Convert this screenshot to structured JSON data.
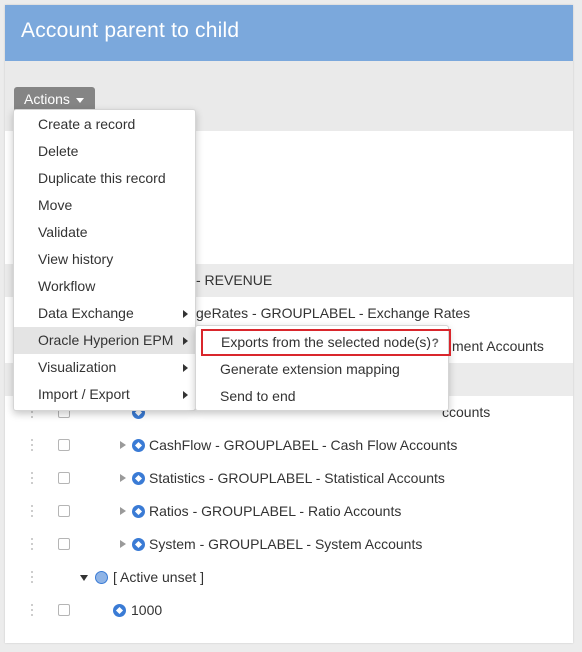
{
  "window": {
    "title": "Account parent to child"
  },
  "toolbar": {
    "actions_label": "Actions"
  },
  "tree": {
    "rows": [
      {
        "text": "- REVENUE"
      },
      {
        "text": "geRates - GROUPLABEL - Exchange Rates"
      },
      {
        "text": "ment Accounts"
      },
      {
        "text": "ccounts"
      },
      {
        "text": "CashFlow - GROUPLABEL - Cash Flow Accounts"
      },
      {
        "text": "Statistics - GROUPLABEL - Statistical Accounts"
      },
      {
        "text": "Ratios - GROUPLABEL - Ratio Accounts"
      },
      {
        "text": "System - GROUPLABEL - System Accounts"
      },
      {
        "text": "[ Active unset ]"
      },
      {
        "text": "1000"
      }
    ]
  },
  "actions_menu": {
    "items": [
      {
        "label": "Create a record"
      },
      {
        "label": "Delete"
      },
      {
        "label": "Duplicate this record"
      },
      {
        "label": "Move"
      },
      {
        "label": "Validate"
      },
      {
        "label": "View history"
      },
      {
        "label": "Workflow"
      },
      {
        "label": "Data Exchange"
      },
      {
        "label": "Oracle Hyperion EPM"
      },
      {
        "label": "Visualization"
      },
      {
        "label": "Import / Export"
      }
    ]
  },
  "hyperion_submenu": {
    "items": [
      {
        "label": "Exports from the selected node(s)",
        "help": "?"
      },
      {
        "label": "Generate extension mapping"
      },
      {
        "label": "Send to end"
      }
    ]
  },
  "colors": {
    "title_bar": "#7ba8dc",
    "actions_button": "#858585",
    "node_icon": "#3a7bd5",
    "highlight_border": "#d9262c"
  }
}
